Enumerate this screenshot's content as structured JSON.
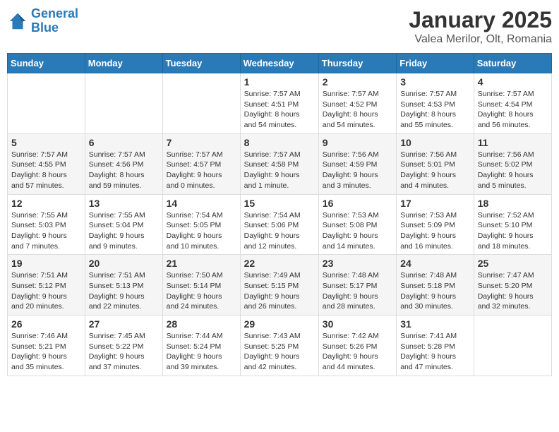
{
  "header": {
    "logo_line1": "General",
    "logo_line2": "Blue",
    "title": "January 2025",
    "subtitle": "Valea Merilor, Olt, Romania"
  },
  "weekdays": [
    "Sunday",
    "Monday",
    "Tuesday",
    "Wednesday",
    "Thursday",
    "Friday",
    "Saturday"
  ],
  "weeks": [
    [
      {
        "day": "",
        "info": ""
      },
      {
        "day": "",
        "info": ""
      },
      {
        "day": "",
        "info": ""
      },
      {
        "day": "1",
        "info": "Sunrise: 7:57 AM\nSunset: 4:51 PM\nDaylight: 8 hours\nand 54 minutes."
      },
      {
        "day": "2",
        "info": "Sunrise: 7:57 AM\nSunset: 4:52 PM\nDaylight: 8 hours\nand 54 minutes."
      },
      {
        "day": "3",
        "info": "Sunrise: 7:57 AM\nSunset: 4:53 PM\nDaylight: 8 hours\nand 55 minutes."
      },
      {
        "day": "4",
        "info": "Sunrise: 7:57 AM\nSunset: 4:54 PM\nDaylight: 8 hours\nand 56 minutes."
      }
    ],
    [
      {
        "day": "5",
        "info": "Sunrise: 7:57 AM\nSunset: 4:55 PM\nDaylight: 8 hours\nand 57 minutes."
      },
      {
        "day": "6",
        "info": "Sunrise: 7:57 AM\nSunset: 4:56 PM\nDaylight: 8 hours\nand 59 minutes."
      },
      {
        "day": "7",
        "info": "Sunrise: 7:57 AM\nSunset: 4:57 PM\nDaylight: 9 hours\nand 0 minutes."
      },
      {
        "day": "8",
        "info": "Sunrise: 7:57 AM\nSunset: 4:58 PM\nDaylight: 9 hours\nand 1 minute."
      },
      {
        "day": "9",
        "info": "Sunrise: 7:56 AM\nSunset: 4:59 PM\nDaylight: 9 hours\nand 3 minutes."
      },
      {
        "day": "10",
        "info": "Sunrise: 7:56 AM\nSunset: 5:01 PM\nDaylight: 9 hours\nand 4 minutes."
      },
      {
        "day": "11",
        "info": "Sunrise: 7:56 AM\nSunset: 5:02 PM\nDaylight: 9 hours\nand 5 minutes."
      }
    ],
    [
      {
        "day": "12",
        "info": "Sunrise: 7:55 AM\nSunset: 5:03 PM\nDaylight: 9 hours\nand 7 minutes."
      },
      {
        "day": "13",
        "info": "Sunrise: 7:55 AM\nSunset: 5:04 PM\nDaylight: 9 hours\nand 9 minutes."
      },
      {
        "day": "14",
        "info": "Sunrise: 7:54 AM\nSunset: 5:05 PM\nDaylight: 9 hours\nand 10 minutes."
      },
      {
        "day": "15",
        "info": "Sunrise: 7:54 AM\nSunset: 5:06 PM\nDaylight: 9 hours\nand 12 minutes."
      },
      {
        "day": "16",
        "info": "Sunrise: 7:53 AM\nSunset: 5:08 PM\nDaylight: 9 hours\nand 14 minutes."
      },
      {
        "day": "17",
        "info": "Sunrise: 7:53 AM\nSunset: 5:09 PM\nDaylight: 9 hours\nand 16 minutes."
      },
      {
        "day": "18",
        "info": "Sunrise: 7:52 AM\nSunset: 5:10 PM\nDaylight: 9 hours\nand 18 minutes."
      }
    ],
    [
      {
        "day": "19",
        "info": "Sunrise: 7:51 AM\nSunset: 5:12 PM\nDaylight: 9 hours\nand 20 minutes."
      },
      {
        "day": "20",
        "info": "Sunrise: 7:51 AM\nSunset: 5:13 PM\nDaylight: 9 hours\nand 22 minutes."
      },
      {
        "day": "21",
        "info": "Sunrise: 7:50 AM\nSunset: 5:14 PM\nDaylight: 9 hours\nand 24 minutes."
      },
      {
        "day": "22",
        "info": "Sunrise: 7:49 AM\nSunset: 5:15 PM\nDaylight: 9 hours\nand 26 minutes."
      },
      {
        "day": "23",
        "info": "Sunrise: 7:48 AM\nSunset: 5:17 PM\nDaylight: 9 hours\nand 28 minutes."
      },
      {
        "day": "24",
        "info": "Sunrise: 7:48 AM\nSunset: 5:18 PM\nDaylight: 9 hours\nand 30 minutes."
      },
      {
        "day": "25",
        "info": "Sunrise: 7:47 AM\nSunset: 5:20 PM\nDaylight: 9 hours\nand 32 minutes."
      }
    ],
    [
      {
        "day": "26",
        "info": "Sunrise: 7:46 AM\nSunset: 5:21 PM\nDaylight: 9 hours\nand 35 minutes."
      },
      {
        "day": "27",
        "info": "Sunrise: 7:45 AM\nSunset: 5:22 PM\nDaylight: 9 hours\nand 37 minutes."
      },
      {
        "day": "28",
        "info": "Sunrise: 7:44 AM\nSunset: 5:24 PM\nDaylight: 9 hours\nand 39 minutes."
      },
      {
        "day": "29",
        "info": "Sunrise: 7:43 AM\nSunset: 5:25 PM\nDaylight: 9 hours\nand 42 minutes."
      },
      {
        "day": "30",
        "info": "Sunrise: 7:42 AM\nSunset: 5:26 PM\nDaylight: 9 hours\nand 44 minutes."
      },
      {
        "day": "31",
        "info": "Sunrise: 7:41 AM\nSunset: 5:28 PM\nDaylight: 9 hours\nand 47 minutes."
      },
      {
        "day": "",
        "info": ""
      }
    ]
  ]
}
